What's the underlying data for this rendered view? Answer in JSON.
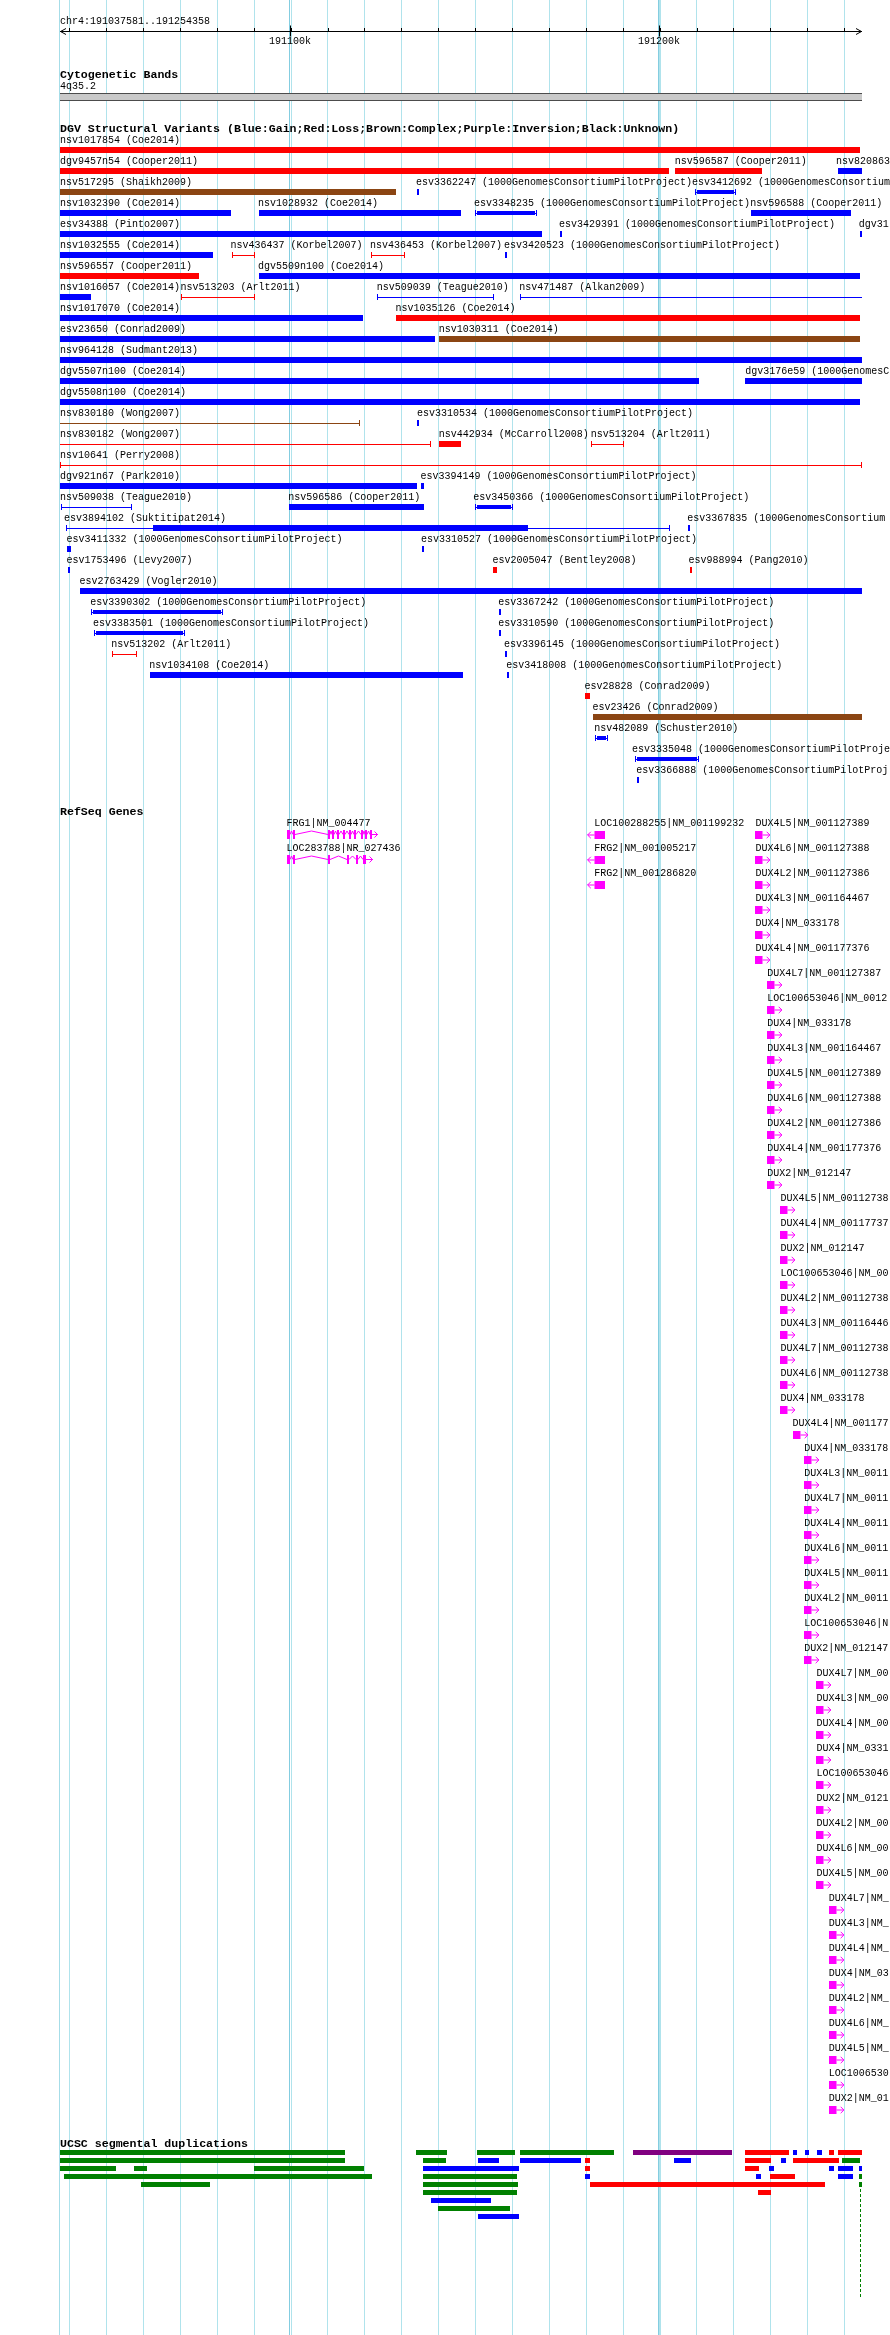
{
  "ruler": {
    "region": "chr4:191037581..191254358",
    "ticks": [
      {
        "label": "191100k"
      },
      {
        "label": "191200k"
      }
    ]
  },
  "cytogenetic_bands": {
    "title": "Cytogenetic Bands",
    "bands": [
      {
        "label": "4q35.2"
      }
    ]
  },
  "dgv_structural_variants": {
    "title": "DGV Structural Variants (Blue:Gain;Red:Loss;Brown:Complex;Purple:Inversion;Black:Unknown)",
    "rows": [
      [
        {
          "label": "nsv1017854 (Coe2014)",
          "color": "#ff0000",
          "kind": "block"
        }
      ],
      [
        {
          "label": "dgv9457n54 (Cooper2011)",
          "color": "#ff0000",
          "kind": "block"
        },
        {
          "label": "nsv596587 (Cooper2011)",
          "color": "#ff0000",
          "kind": "block"
        },
        {
          "label": "nsv820863",
          "color": "#0000ff",
          "kind": "block"
        }
      ],
      [
        {
          "label": "nsv517295 (Shaikh2009)",
          "color": "#8b4513",
          "kind": "block"
        },
        {
          "label": "esv3362247 (1000GenomesConsortiumPilotProject)",
          "color": "#0000ff",
          "kind": "block"
        },
        {
          "label": "esv3412692 (1000GenomesConsortium",
          "color": "#0000ff",
          "kind": "capped"
        }
      ],
      [
        {
          "label": "nsv1032390 (Coe2014)",
          "color": "#0000ff",
          "kind": "block"
        },
        {
          "label": "nsv1028932 (Coe2014)",
          "color": "#0000ff",
          "kind": "block"
        },
        {
          "label": "esv3348235 (1000GenomesConsortiumPilotProject)",
          "color": "#0000ff",
          "kind": "capped"
        },
        {
          "label": "nsv596588 (Cooper2011)",
          "color": "#0000ff",
          "kind": "block"
        }
      ],
      [
        {
          "label": "esv34388 (Pinto2007)",
          "color": "#0000ff",
          "kind": "block"
        },
        {
          "label": "esv3429391 (1000GenomesConsortiumPilotProject)",
          "color": "#0000ff",
          "kind": "block"
        },
        {
          "label": "dgv31",
          "color": "#0000ff",
          "kind": "block"
        }
      ],
      [
        {
          "label": "nsv1032555 (Coe2014)",
          "color": "#0000ff",
          "kind": "block"
        },
        {
          "label": "nsv436437 (Korbel2007)",
          "color": "#ff0000",
          "kind": "bracket"
        },
        {
          "label": "nsv436453 (Korbel2007)",
          "color": "#ff0000",
          "kind": "bracket"
        },
        {
          "label": "esv3420523 (1000GenomesConsortiumPilotProject)",
          "color": "#0000ff",
          "kind": "block"
        }
      ],
      [
        {
          "label": "nsv596557 (Cooper2011)",
          "color": "#ff0000",
          "kind": "block"
        },
        {
          "label": "dgv5509n100 (Coe2014)",
          "color": "#0000ff",
          "kind": "block"
        }
      ],
      [
        {
          "label": "nsv1016057 (Coe2014)",
          "color": "#0000ff",
          "kind": "block"
        },
        {
          "label": "nsv513203 (Arlt2011)",
          "color": "#ff0000",
          "kind": "bracket"
        },
        {
          "label": "nsv509039 (Teague2010)",
          "color": "#0000ff",
          "kind": "bracket"
        },
        {
          "label": "nsv471487 (Alkan2009)",
          "color": "#0000ff",
          "kind": "bracket"
        }
      ],
      [
        {
          "label": "nsv1017070 (Coe2014)",
          "color": "#0000ff",
          "kind": "block"
        },
        {
          "label": "nsv1035126 (Coe2014)",
          "color": "#ff0000",
          "kind": "block"
        }
      ],
      [
        {
          "label": "esv23650 (Conrad2009)",
          "color": "#0000ff",
          "kind": "block"
        },
        {
          "label": "nsv1030311 (Coe2014)",
          "color": "#8b4513",
          "kind": "block"
        }
      ],
      [
        {
          "label": "nsv964128 (Sudmant2013)",
          "color": "#0000ff",
          "kind": "block"
        }
      ],
      [
        {
          "label": "dgv5507n100 (Coe2014)",
          "color": "#0000ff",
          "kind": "block"
        },
        {
          "label": "dgv3176e59 (1000GenomesC",
          "color": "#0000ff",
          "kind": "block"
        }
      ],
      [
        {
          "label": "dgv5508n100 (Coe2014)",
          "color": "#0000ff",
          "kind": "block"
        }
      ],
      [
        {
          "label": "nsv830180 (Wong2007)",
          "color": "#8b4513",
          "kind": "bracket"
        },
        {
          "label": "esv3310534 (1000GenomesConsortiumPilotProject)",
          "color": "#0000ff",
          "kind": "block"
        }
      ],
      [
        {
          "label": "nsv830182 (Wong2007)",
          "color": "#ff0000",
          "kind": "bracket"
        },
        {
          "label": "nsv442934 (McCarroll2008)",
          "color": "#ff0000",
          "kind": "block"
        },
        {
          "label": "nsv513204 (Arlt2011)",
          "color": "#ff0000",
          "kind": "bracket"
        }
      ],
      [
        {
          "label": "nsv10641 (Perry2008)",
          "color": "#ff0000",
          "kind": "bracket"
        }
      ],
      [
        {
          "label": "dgv921n67 (Park2010)",
          "color": "#0000ff",
          "kind": "block"
        },
        {
          "label": "esv3394149 (1000GenomesConsortiumPilotProject)",
          "color": "#0000ff",
          "kind": "block"
        }
      ],
      [
        {
          "label": "nsv509038 (Teague2010)",
          "color": "#0000ff",
          "kind": "bracket"
        },
        {
          "label": "nsv596586 (Cooper2011)",
          "color": "#0000ff",
          "kind": "block"
        },
        {
          "label": "esv3450366 (1000GenomesConsortiumPilotProject)",
          "color": "#0000ff",
          "kind": "capped"
        }
      ],
      [
        {
          "label": "esv3894102 (Suktitipat2014)",
          "color": "#0000ff",
          "kind": "split"
        },
        {
          "label": "esv3367835 (1000GenomesConsortium",
          "color": "#0000ff",
          "kind": "block"
        }
      ],
      [
        {
          "label": "esv3411332 (1000GenomesConsortiumPilotProject)",
          "color": "#0000ff",
          "kind": "block"
        },
        {
          "label": "esv3310527 (1000GenomesConsortiumPilotProject)",
          "color": "#0000ff",
          "kind": "block"
        }
      ],
      [
        {
          "label": "esv1753496 (Levy2007)",
          "color": "#0000ff",
          "kind": "block"
        },
        {
          "label": "esv2005047 (Bentley2008)",
          "color": "#ff0000",
          "kind": "block"
        },
        {
          "label": "esv988994 (Pang2010)",
          "color": "#ff0000",
          "kind": "block"
        }
      ],
      [
        {
          "label": "esv2763429 (Vogler2010)",
          "color": "#0000ff",
          "kind": "block"
        }
      ],
      [
        {
          "label": "esv3390302 (1000GenomesConsortiumPilotProject)",
          "color": "#0000ff",
          "kind": "capped"
        },
        {
          "label": "esv3367242 (1000GenomesConsortiumPilotProject)",
          "color": "#0000ff",
          "kind": "block"
        }
      ],
      [
        {
          "label": "esv3383501 (1000GenomesConsortiumPilotProject)",
          "color": "#0000ff",
          "kind": "capped"
        },
        {
          "label": "esv3310590 (1000GenomesConsortiumPilotProject)",
          "color": "#0000ff",
          "kind": "block"
        }
      ],
      [
        {
          "label": "nsv513202 (Arlt2011)",
          "color": "#ff0000",
          "kind": "bracket"
        },
        {
          "label": "esv3396145 (1000GenomesConsortiumPilotProject)",
          "color": "#0000ff",
          "kind": "block"
        }
      ],
      [
        {
          "label": "nsv1034108 (Coe2014)",
          "color": "#0000ff",
          "kind": "block"
        },
        {
          "label": "esv3418008 (1000GenomesConsortiumPilotProject)",
          "color": "#0000ff",
          "kind": "block"
        }
      ],
      [
        {
          "label": "esv28828 (Conrad2009)",
          "color": "#ff0000",
          "kind": "block"
        }
      ],
      [
        {
          "label": "esv23426 (Conrad2009)",
          "color": "#8b4513",
          "kind": "block"
        }
      ],
      [
        {
          "label": "nsv482089 (Schuster2010)",
          "color": "#0000ff",
          "kind": "capped"
        }
      ],
      [
        {
          "label": "esv3335048 (1000GenomesConsortiumPilotProje",
          "color": "#0000ff",
          "kind": "capped"
        }
      ],
      [
        {
          "label": "esv3366888 (1000GenomesConsortiumPilotProj",
          "color": "#0000ff",
          "kind": "block"
        }
      ]
    ]
  },
  "refseq_genes": {
    "title": "RefSeq Genes",
    "genes": [
      {
        "label": "FRG1|NM_004477",
        "reverse": false,
        "kind": "multi-exon"
      },
      {
        "label": "LOC100288255|NM_001199232",
        "reverse": true,
        "kind": "single-exon"
      },
      {
        "label": "DUX4L5|NM_001127389",
        "reverse": false,
        "kind": "single-exon"
      },
      {
        "label": "LOC283788|NR_027436",
        "reverse": false,
        "kind": "multi-exon"
      },
      {
        "label": "FRG2|NM_001005217",
        "reverse": true,
        "kind": "single-exon"
      },
      {
        "label": "DUX4L6|NM_001127388",
        "reverse": false,
        "kind": "single-exon"
      },
      {
        "label": "FRG2|NM_001286820",
        "reverse": true,
        "kind": "single-exon"
      },
      {
        "label": "DUX4L2|NM_001127386",
        "reverse": false,
        "kind": "single-exon"
      },
      {
        "label": "DUX4L3|NM_001164467",
        "reverse": false,
        "kind": "single-exon"
      },
      {
        "label": "DUX4|NM_033178",
        "reverse": false,
        "kind": "single-exon"
      },
      {
        "label": "DUX4L4|NM_001177376",
        "reverse": false,
        "kind": "single-exon"
      },
      {
        "label": "DUX4L7|NM_001127387",
        "reverse": false,
        "kind": "single-exon"
      },
      {
        "label": "LOC100653046|NM_0012",
        "reverse": false,
        "kind": "single-exon"
      },
      {
        "label": "DUX4|NM_033178",
        "reverse": false,
        "kind": "single-exon"
      },
      {
        "label": "DUX4L3|NM_001164467",
        "reverse": false,
        "kind": "single-exon"
      },
      {
        "label": "DUX4L5|NM_001127389",
        "reverse": false,
        "kind": "single-exon"
      },
      {
        "label": "DUX4L6|NM_001127388",
        "reverse": false,
        "kind": "single-exon"
      },
      {
        "label": "DUX4L2|NM_001127386",
        "reverse": false,
        "kind": "single-exon"
      },
      {
        "label": "DUX4L4|NM_001177376",
        "reverse": false,
        "kind": "single-exon"
      },
      {
        "label": "DUX2|NM_012147",
        "reverse": false,
        "kind": "single-exon"
      },
      {
        "label": "DUX4L5|NM_00112738",
        "reverse": false,
        "kind": "single-exon"
      },
      {
        "label": "DUX4L4|NM_00117737",
        "reverse": false,
        "kind": "single-exon"
      },
      {
        "label": "DUX2|NM_012147",
        "reverse": false,
        "kind": "single-exon"
      },
      {
        "label": "LOC100653046|NM_00",
        "reverse": false,
        "kind": "single-exon"
      },
      {
        "label": "DUX4L2|NM_00112738",
        "reverse": false,
        "kind": "single-exon"
      },
      {
        "label": "DUX4L3|NM_00116446",
        "reverse": false,
        "kind": "single-exon"
      },
      {
        "label": "DUX4L7|NM_00112738",
        "reverse": false,
        "kind": "single-exon"
      },
      {
        "label": "DUX4L6|NM_00112738",
        "reverse": false,
        "kind": "single-exon"
      },
      {
        "label": "DUX4|NM_033178",
        "reverse": false,
        "kind": "single-exon"
      },
      {
        "label": "DUX4L4|NM_001177",
        "reverse": false,
        "kind": "single-exon"
      },
      {
        "label": "DUX4|NM_033178",
        "reverse": false,
        "kind": "single-exon"
      },
      {
        "label": "DUX4L3|NM_0011",
        "reverse": false,
        "kind": "single-exon"
      },
      {
        "label": "DUX4L7|NM_0011",
        "reverse": false,
        "kind": "single-exon"
      },
      {
        "label": "DUX4L4|NM_0011",
        "reverse": false,
        "kind": "single-exon"
      },
      {
        "label": "DUX4L6|NM_0011",
        "reverse": false,
        "kind": "single-exon"
      },
      {
        "label": "DUX4L5|NM_0011",
        "reverse": false,
        "kind": "single-exon"
      },
      {
        "label": "DUX4L2|NM_0011",
        "reverse": false,
        "kind": "single-exon"
      },
      {
        "label": "LOC100653046|N",
        "reverse": false,
        "kind": "single-exon"
      },
      {
        "label": "DUX2|NM_012147",
        "reverse": false,
        "kind": "single-exon"
      },
      {
        "label": "DUX4L7|NM_00",
        "reverse": false,
        "kind": "single-exon"
      },
      {
        "label": "DUX4L3|NM_00",
        "reverse": false,
        "kind": "single-exon"
      },
      {
        "label": "DUX4L4|NM_00",
        "reverse": false,
        "kind": "single-exon"
      },
      {
        "label": "DUX4|NM_0331",
        "reverse": false,
        "kind": "single-exon"
      },
      {
        "label": "LOC100653046",
        "reverse": false,
        "kind": "single-exon"
      },
      {
        "label": "DUX2|NM_0121",
        "reverse": false,
        "kind": "single-exon"
      },
      {
        "label": "DUX4L2|NM_00",
        "reverse": false,
        "kind": "single-exon"
      },
      {
        "label": "DUX4L6|NM_00",
        "reverse": false,
        "kind": "single-exon"
      },
      {
        "label": "DUX4L5|NM_00",
        "reverse": false,
        "kind": "single-exon"
      },
      {
        "label": "DUX4L7|NM_",
        "reverse": false,
        "kind": "single-exon"
      },
      {
        "label": "DUX4L3|NM_",
        "reverse": false,
        "kind": "single-exon"
      },
      {
        "label": "DUX4L4|NM_",
        "reverse": false,
        "kind": "single-exon"
      },
      {
        "label": "DUX4|NM_03",
        "reverse": false,
        "kind": "single-exon"
      },
      {
        "label": "DUX4L2|NM_",
        "reverse": false,
        "kind": "single-exon"
      },
      {
        "label": "DUX4L6|NM_",
        "reverse": false,
        "kind": "single-exon"
      },
      {
        "label": "DUX4L5|NM_",
        "reverse": false,
        "kind": "single-exon"
      },
      {
        "label": "LOC1006530",
        "reverse": false,
        "kind": "single-exon"
      },
      {
        "label": "DUX2|NM_01",
        "reverse": false,
        "kind": "single-exon"
      }
    ]
  },
  "segmental_duplications": {
    "title": "UCSC segmental duplications",
    "rows": [
      [
        {
          "color": "#008000"
        },
        {
          "color": "#008000"
        },
        {
          "color": "#008000"
        },
        {
          "color": "#008000"
        },
        {
          "color": "#800080"
        },
        {
          "color": "#ff0000"
        },
        {
          "color": "#0000ff"
        },
        {
          "color": "#0000ff"
        },
        {
          "color": "#0000ff"
        },
        {
          "color": "#ff0000"
        },
        {
          "color": "#ff0000"
        }
      ],
      [
        {
          "color": "#008000"
        },
        {
          "color": "#008000"
        },
        {
          "color": "#0000ff"
        },
        {
          "color": "#0000ff"
        },
        {
          "color": "#ff0000"
        },
        {
          "color": "#0000ff"
        },
        {
          "color": "#ff0000"
        },
        {
          "color": "#0000ff"
        },
        {
          "color": "#ff0000"
        },
        {
          "color": "#008000"
        }
      ],
      [
        {
          "color": "#008000"
        },
        {
          "color": "#008000"
        },
        {
          "color": "#008000"
        },
        {
          "color": "#0000ff"
        },
        {
          "color": "#ff0000"
        },
        {
          "color": "#ff0000"
        },
        {
          "color": "#0000ff"
        },
        {
          "color": "#0000ff"
        },
        {
          "color": "#0000ff"
        },
        {
          "color": "#0000ff"
        }
      ],
      [
        {
          "color": "#008000"
        },
        {
          "color": "#008000"
        },
        {
          "color": "#0000ff"
        },
        {
          "color": "#0000ff"
        },
        {
          "color": "#ff0000"
        },
        {
          "color": "#0000ff"
        },
        {
          "color": "#008000"
        }
      ],
      [
        {
          "color": "#008000"
        },
        {
          "color": "#008000"
        },
        {
          "color": "#ff0000"
        },
        {
          "color": "#008000"
        }
      ],
      [
        {
          "color": "#008000"
        },
        {
          "color": "#ff0000"
        }
      ],
      [
        {
          "color": "#0000ff"
        }
      ],
      [
        {
          "color": "#008000"
        }
      ],
      [
        {
          "color": "#0000ff"
        }
      ]
    ]
  }
}
